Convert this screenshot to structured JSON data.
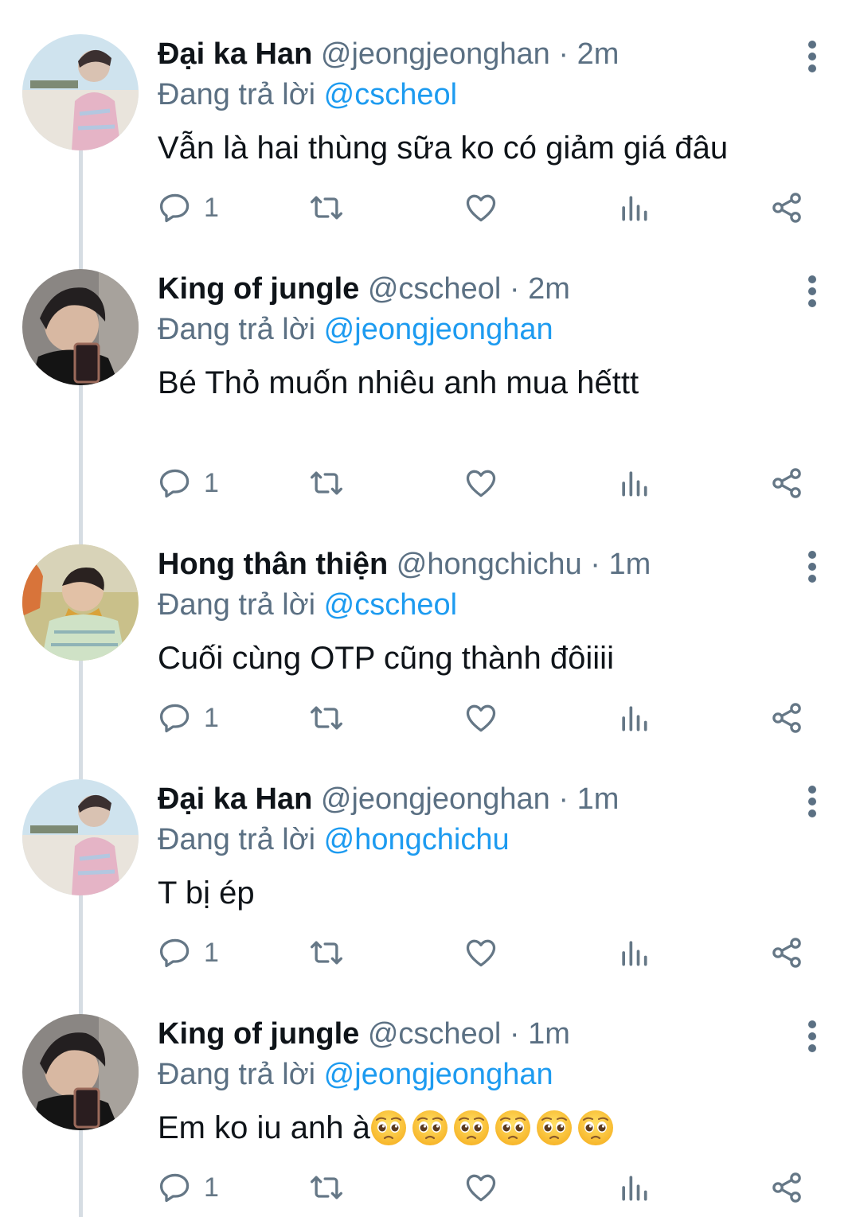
{
  "reply_prefix": "Đang trả lời",
  "tweets": [
    {
      "name": "Đại ka Han",
      "handle": "@jeongjeonghan",
      "time": "2m",
      "reply_to": "@cscheol",
      "text": "Vẫn là hai thùng sữa ko có giảm giá đâu",
      "reply_count": "1",
      "avatar": "avatar-han"
    },
    {
      "name": "King of jungle",
      "handle": "@cscheol",
      "time": "2m",
      "reply_to": "@jeongjeonghan",
      "text": "Bé Thỏ muốn nhiêu anh mua hếttt",
      "reply_count": "1",
      "avatar": "avatar-cheol"
    },
    {
      "name": "Hong thân thiện",
      "handle": "@hongchichu",
      "time": "1m",
      "reply_to": "@cscheol",
      "text": "Cuối cùng OTP cũng thành đôiiii",
      "reply_count": "1",
      "avatar": "avatar-hong"
    },
    {
      "name": "Đại ka Han",
      "handle": "@jeongjeonghan",
      "time": "1m",
      "reply_to": "@hongchichu",
      "text": "T bị ép",
      "reply_count": "1",
      "avatar": "avatar-han"
    },
    {
      "name": "King of jungle",
      "handle": "@cscheol",
      "time": "1m",
      "reply_to": "@jeongjeonghan",
      "text": "Em ko iu anh à",
      "reply_count": "1",
      "avatar": "avatar-cheol",
      "emoji_name": "pleading-face-emoji",
      "emoji_count": 6
    }
  ],
  "colors": {
    "text": "#0f1419",
    "secondary": "#5b7083",
    "mention": "#1d9bf0",
    "thread_line": "#d6dde3"
  }
}
